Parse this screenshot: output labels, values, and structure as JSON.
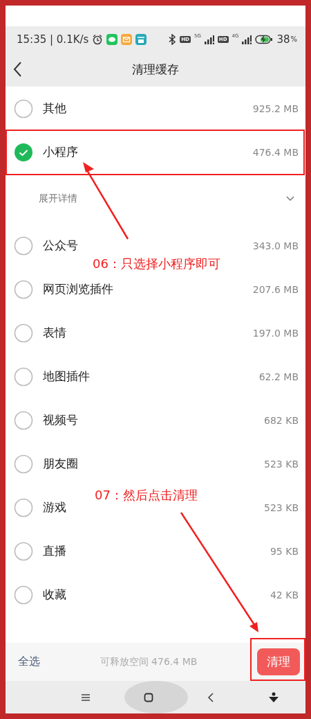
{
  "status_bar": {
    "time": "15:35 | 0.1K/s",
    "sim1_badge": "HD",
    "sim1_network": "5G",
    "sim2_badge": "HD",
    "sim2_network": "4G",
    "battery": "38",
    "battery_unit": "%"
  },
  "header": {
    "title": "清理缓存"
  },
  "items": [
    {
      "kind": "item",
      "label": "其他",
      "size": "925.2 MB",
      "selected": false
    },
    {
      "kind": "item",
      "label": "小程序",
      "size": "476.4 MB",
      "selected": true
    },
    {
      "kind": "expander",
      "label": "展开详情",
      "expanded": false
    },
    {
      "kind": "item",
      "label": "公众号",
      "size": "343.0 MB",
      "selected": false
    },
    {
      "kind": "item",
      "label": "网页浏览插件",
      "size": "207.6 MB",
      "selected": false
    },
    {
      "kind": "item",
      "label": "表情",
      "size": "197.0 MB",
      "selected": false
    },
    {
      "kind": "item",
      "label": "地图插件",
      "size": "62.2 MB",
      "selected": false
    },
    {
      "kind": "item",
      "label": "视频号",
      "size": "682 KB",
      "selected": false
    },
    {
      "kind": "item",
      "label": "朋友圈",
      "size": "523 KB",
      "selected": false
    },
    {
      "kind": "item",
      "label": "游戏",
      "size": "523 KB",
      "selected": false
    },
    {
      "kind": "item",
      "label": "直播",
      "size": "95 KB",
      "selected": false
    },
    {
      "kind": "item",
      "label": "收藏",
      "size": "42 KB",
      "selected": false
    }
  ],
  "footer": {
    "select_all": "全选",
    "freeable": "可释放空间 476.4 MB",
    "clean_button": "清理"
  },
  "annotations": [
    {
      "text": "06：只选择小程序即可"
    },
    {
      "text": "07：然后点击清理"
    }
  ]
}
